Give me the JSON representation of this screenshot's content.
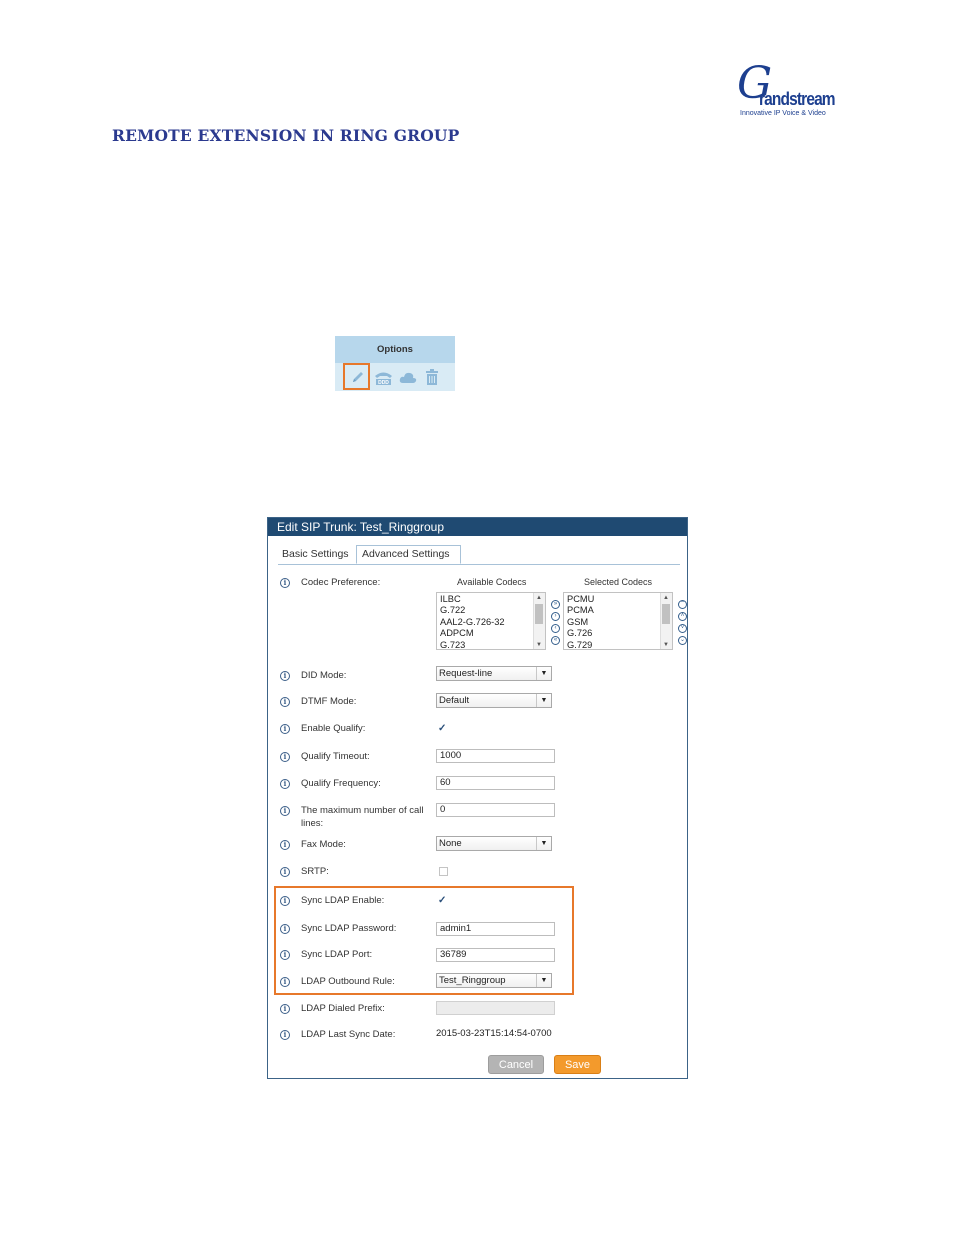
{
  "logo": {
    "script_letter": "G",
    "word": "randstream",
    "tagline": "Innovative IP Voice & Video"
  },
  "heading": "REMOTE EXTENSION IN RING GROUP",
  "options_table": {
    "header": "Options",
    "icons": [
      "edit-icon",
      "ddd-icon",
      "cloud-icon",
      "trash-icon"
    ]
  },
  "dialog": {
    "title": "Edit SIP Trunk: Test_Ringgroup",
    "tabs": {
      "basic": "Basic Settings",
      "advanced": "Advanced Settings"
    },
    "codec": {
      "label": "Codec Preference:",
      "available_header": "Available Codecs",
      "selected_header": "Selected Codecs",
      "available": [
        "ILBC",
        "G.722",
        "AAL2-G.726-32",
        "ADPCM",
        "G.723"
      ],
      "selected": [
        "PCMU",
        "PCMA",
        "GSM",
        "G.726",
        "G.729"
      ]
    },
    "fields": {
      "did_mode": {
        "label": "DID Mode:",
        "value": "Request-line"
      },
      "dtmf_mode": {
        "label": "DTMF Mode:",
        "value": "Default"
      },
      "enable_qualify": {
        "label": "Enable Qualify:",
        "checked": true
      },
      "qualify_timeout": {
        "label": "Qualify Timeout:",
        "value": "1000"
      },
      "qualify_frequency": {
        "label": "Qualify Frequency:",
        "value": "60"
      },
      "max_call_lines": {
        "label_line1": "The maximum number of call",
        "label_line2": "lines:",
        "value": "0"
      },
      "fax_mode": {
        "label": "Fax Mode:",
        "value": "None"
      },
      "srtp": {
        "label": "SRTP:",
        "checked": false
      },
      "sync_ldap_enable": {
        "label": "Sync LDAP Enable:",
        "checked": true
      },
      "sync_ldap_password": {
        "label": "Sync LDAP Password:",
        "value": "admin1"
      },
      "sync_ldap_port": {
        "label": "Sync LDAP Port:",
        "value": "36789"
      },
      "ldap_outbound_rule": {
        "label": "LDAP Outbound Rule:",
        "value": "Test_Ringgroup"
      },
      "ldap_dialed_prefix": {
        "label": "LDAP Dialed Prefix:",
        "value": ""
      },
      "ldap_last_sync_date": {
        "label": "LDAP Last Sync Date:",
        "value": "2015-03-23T15:14:54-0700"
      }
    },
    "buttons": {
      "cancel": "Cancel",
      "save": "Save"
    }
  },
  "colors": {
    "accent_orange": "#e7782b",
    "title_bar": "#1f4a72",
    "heading": "#2b3a8f",
    "save_button": "#f39a2c"
  }
}
